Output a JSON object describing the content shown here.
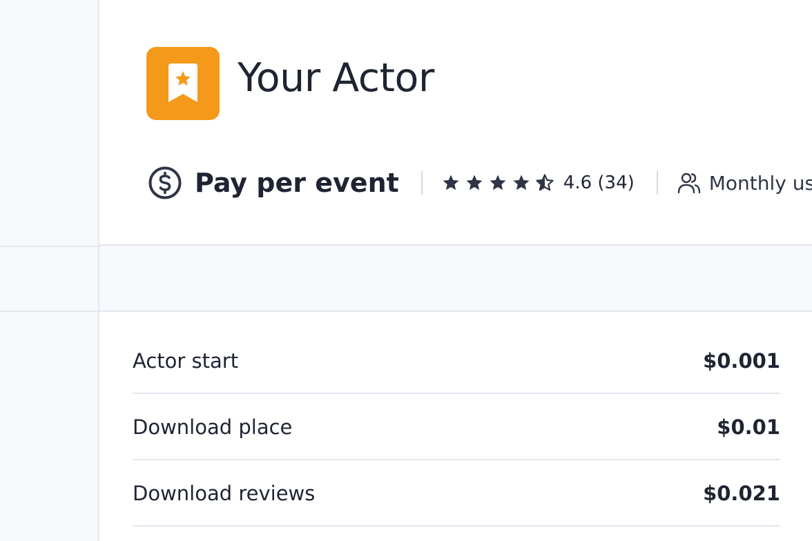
{
  "actor": {
    "title": "Your Actor",
    "icon": "bookmark-star-icon",
    "icon_color": "#f4991a"
  },
  "meta": {
    "pricing_icon": "dollar-circle-icon",
    "pricing_model": "Pay per event",
    "rating_stars": 4.6,
    "rating_text": "4.6 (34)",
    "users_icon": "users-icon",
    "users_label": "Monthly users"
  },
  "pricing_events": [
    {
      "name": "Actor start",
      "price": "$0.001"
    },
    {
      "name": "Download place",
      "price": "$0.01"
    },
    {
      "name": "Download reviews",
      "price": "$0.021"
    }
  ]
}
